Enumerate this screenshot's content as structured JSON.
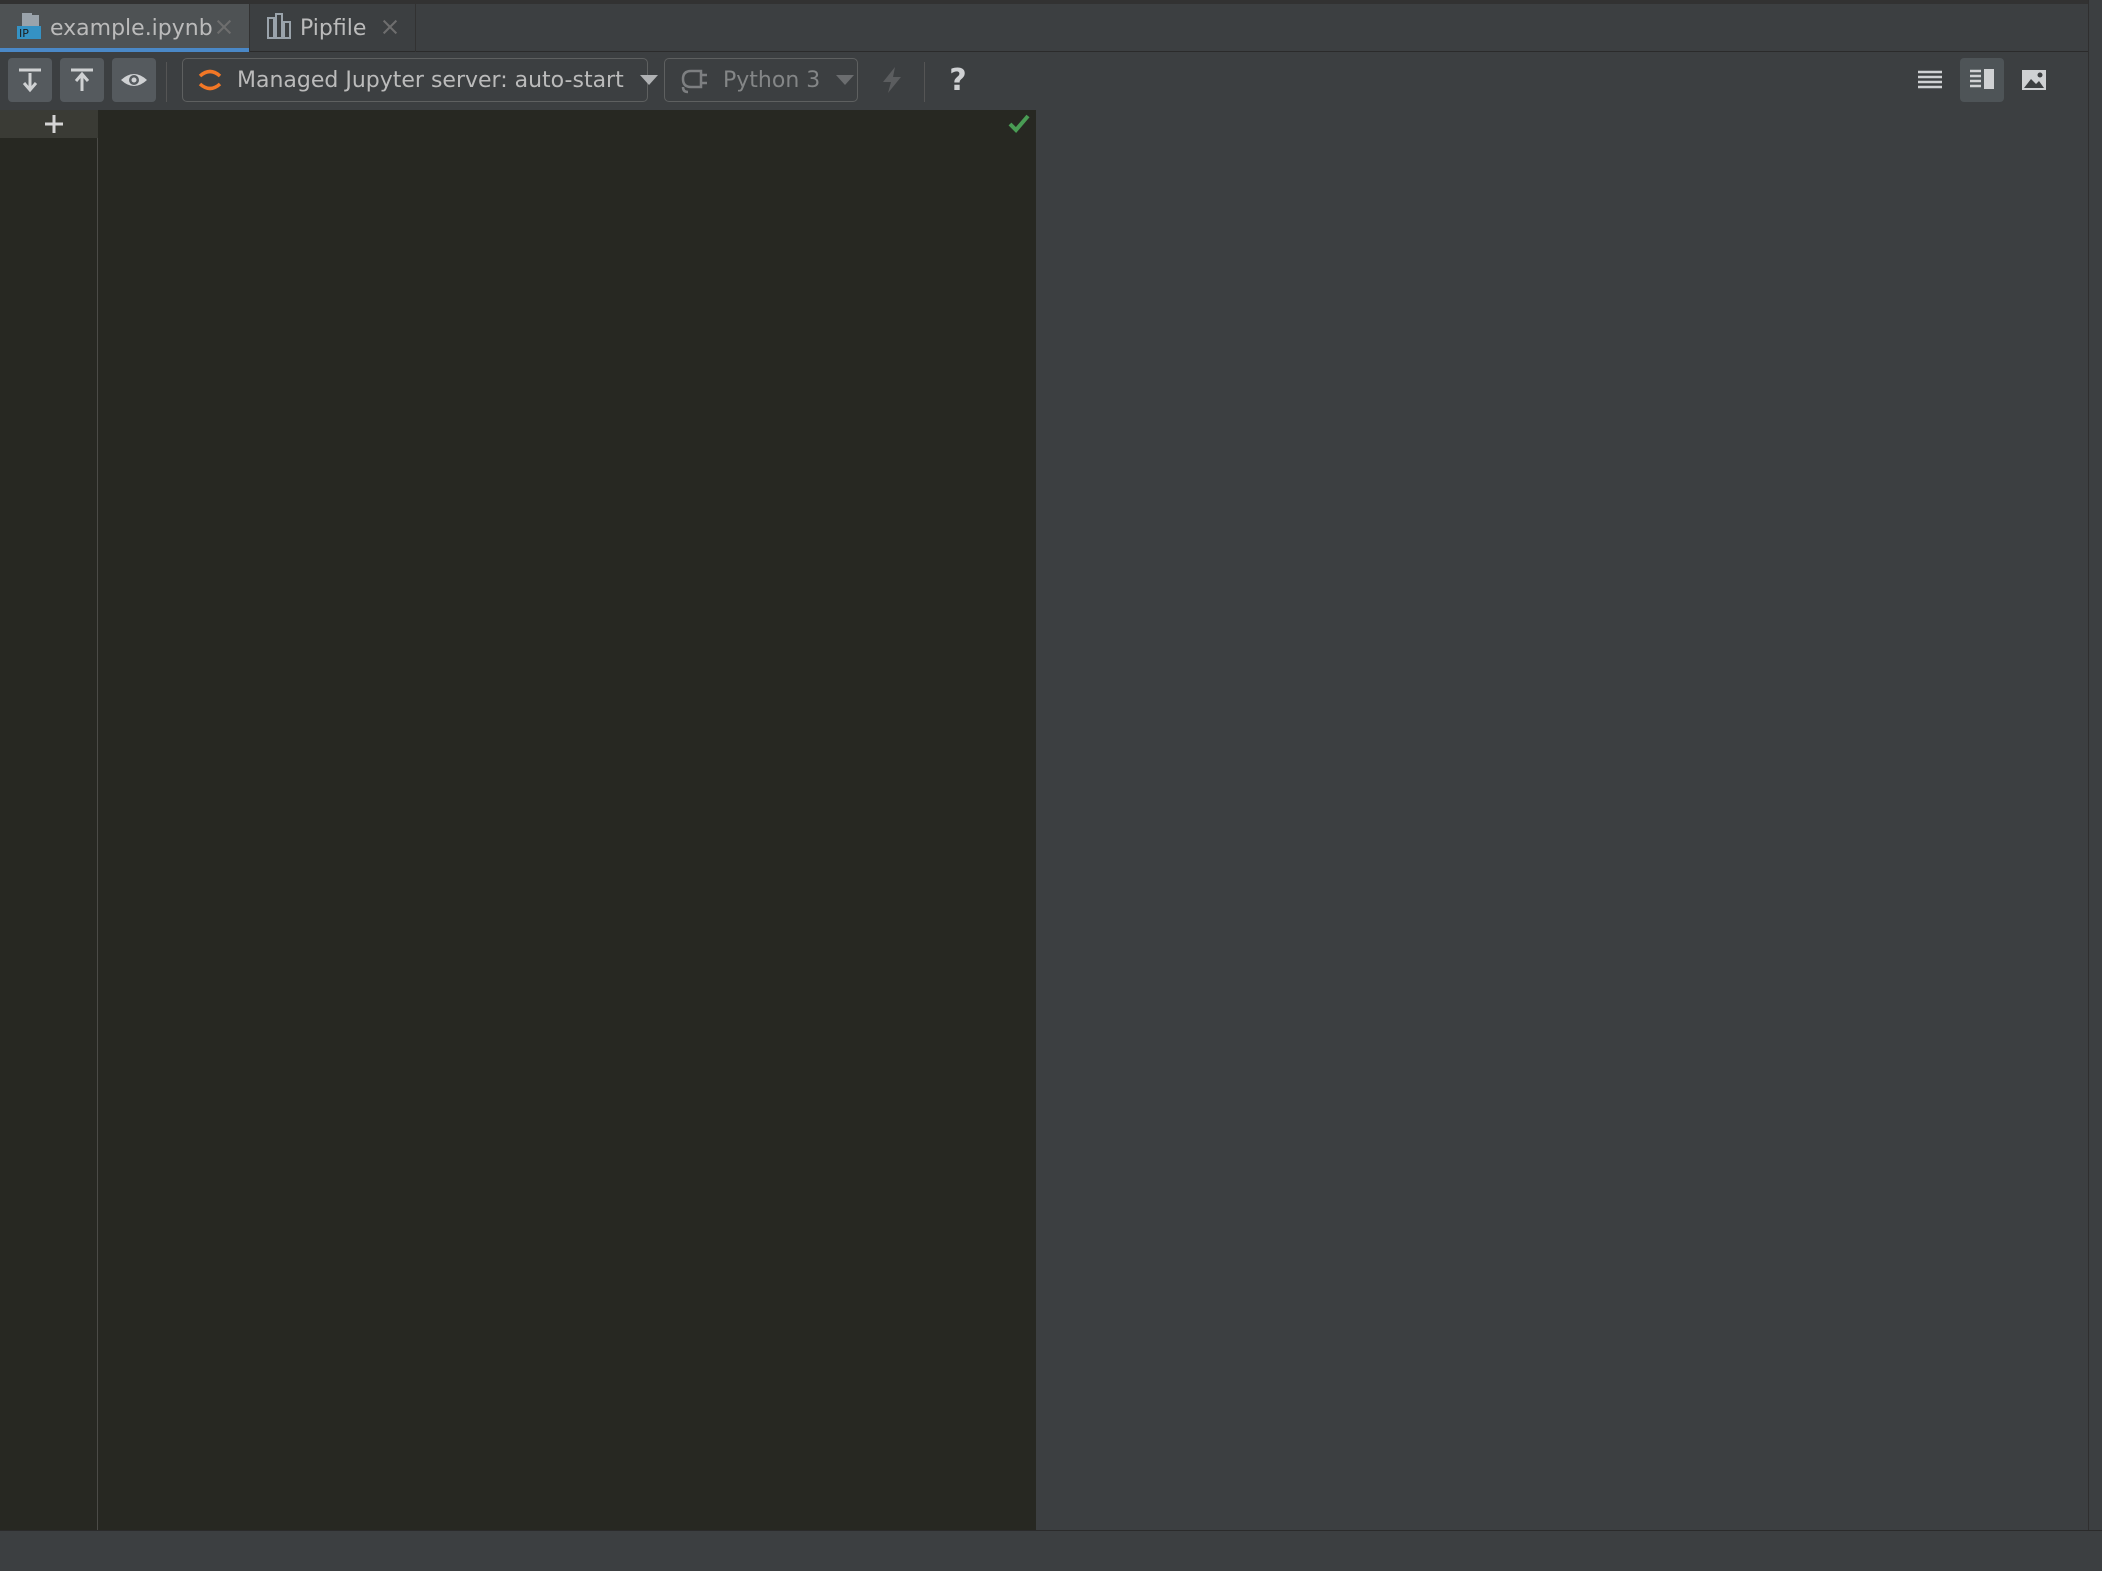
{
  "tabs": [
    {
      "label": "example.ipynb",
      "icon": "ipynb-file-icon",
      "active": true
    },
    {
      "label": "Pipfile",
      "icon": "pipfile-icon",
      "active": false
    }
  ],
  "toolbar": {
    "run_cell_icon": "run-cell-icon",
    "run_all_icon": "run-all-above-icon",
    "preview_icon": "eye-icon",
    "server_label": "Managed Jupyter server: auto-start",
    "kernel_label": "Python 3",
    "help_label": "?",
    "view_modes": [
      "editor-only",
      "split",
      "preview-only"
    ],
    "active_view_mode": "split"
  },
  "colors": {
    "accent": "#4a88c7",
    "jupyter_orange": "#f37726",
    "success": "#499c54",
    "editor_bg": "#272822",
    "panel_bg": "#3c3f41"
  }
}
